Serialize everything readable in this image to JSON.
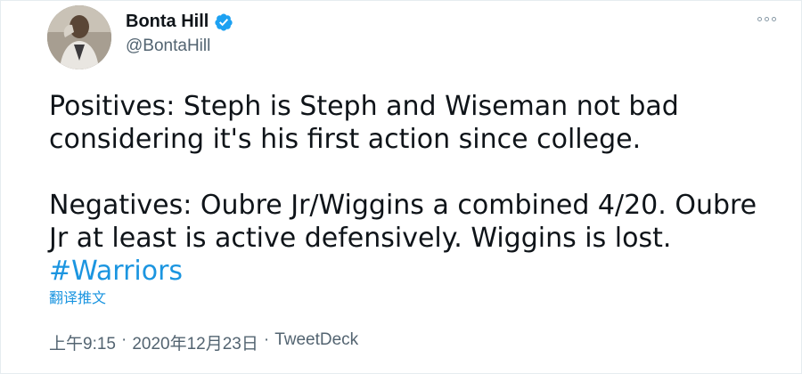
{
  "author": {
    "display_name": "Bonta Hill",
    "handle": "@BontaHill",
    "verified_icon": "verified-badge-icon",
    "verified_color": "#1da1f2"
  },
  "menu": {
    "icon": "more-options-icon"
  },
  "tweet": {
    "paragraph_1": "Positives: Steph is Steph and Wiseman not bad considering it's his first action since college.",
    "paragraph_2_text": "Negatives: Oubre Jr/Wiggins a combined 4/20. Oubre Jr at least is active defensively. Wiggins is lost.",
    "hashtag": "#Warriors",
    "hashtag_color": "#1b95e0",
    "translate_link": "翻译推文"
  },
  "meta": {
    "time": "上午9:15",
    "separator_1": "·",
    "date": "2020年12月23日",
    "separator_2": "·",
    "source": "TweetDeck"
  }
}
